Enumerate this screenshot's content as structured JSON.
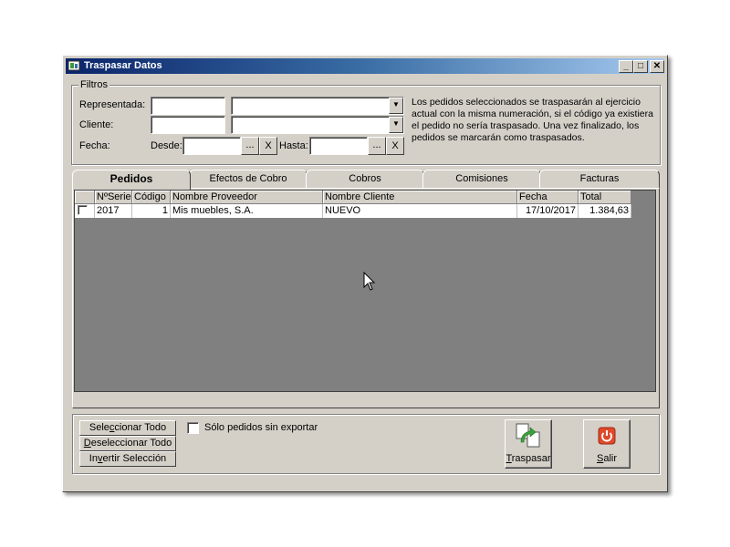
{
  "window": {
    "title": "Traspasar Datos",
    "minimize": "_",
    "maximize": "□",
    "close": "✕"
  },
  "filters": {
    "legend": "Filtros",
    "representada_label": "Representada:",
    "cliente_label": "Cliente:",
    "fecha_label": "Fecha:",
    "desde_label": "Desde:",
    "hasta_label": "Hasta:",
    "browse": "...",
    "clear": "X",
    "info": "Los pedidos seleccionados se traspasarán al ejercicio actual con la misma numeración, si el código ya existiera el pedido no sería traspasado. Una vez finalizado, los pedidos se marcarán como traspasados."
  },
  "tabs": [
    {
      "label": "Pedidos"
    },
    {
      "label": "Efectos de Cobro"
    },
    {
      "label": "Cobros"
    },
    {
      "label": "Comisiones"
    },
    {
      "label": "Facturas"
    }
  ],
  "grid": {
    "columns": [
      "NºSerie",
      "Código",
      "Nombre Proveedor",
      "Nombre Cliente",
      "Fecha",
      "Total"
    ],
    "rows": [
      {
        "serie": "2017",
        "codigo": "1",
        "proveedor": "Mis muebles, S.A.",
        "cliente": "NUEVO",
        "fecha": "17/10/2017",
        "total": "1.384,63"
      }
    ]
  },
  "bottom": {
    "select_all_pre": "Sele",
    "select_all_u": "c",
    "select_all_post": "cionar Todo",
    "deselect_pre": "",
    "deselect_u": "D",
    "deselect_post": "eseleccionar Todo",
    "invert_pre": "In",
    "invert_u": "v",
    "invert_post": "ertir Selección",
    "only_unexported": "Sólo pedidos sin exportar",
    "traspasar_u": "T",
    "traspasar_post": "raspasar",
    "salir_u": "S",
    "salir_post": "alir"
  }
}
